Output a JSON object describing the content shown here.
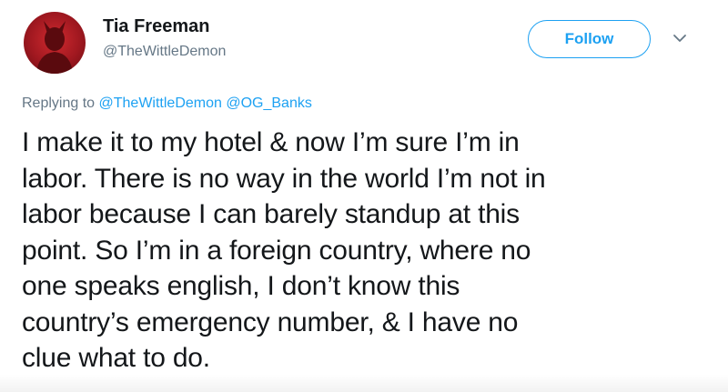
{
  "author": {
    "display_name": "Tia Freeman",
    "handle": "@TheWittleDemon",
    "avatar_icon": "devil-silhouette-avatar",
    "avatar_color": "#c0232a"
  },
  "actions": {
    "follow_label": "Follow",
    "more_icon": "chevron-down-icon",
    "accent_color": "#1da1f2"
  },
  "reply": {
    "prefix": "Replying to",
    "mentions": [
      "@TheWittleDemon",
      "@OG_Banks"
    ]
  },
  "tweet": {
    "lines": [
      "I make it to my hotel & now I’m sure I’m in",
      "labor. There is no way in the world I’m not in",
      "labor because I can barely standup at this",
      "point. So I’m in a foreign country, where no",
      "one speaks english, I don’t know this",
      "country’s emergency number, & I have no",
      "clue what to do."
    ]
  }
}
